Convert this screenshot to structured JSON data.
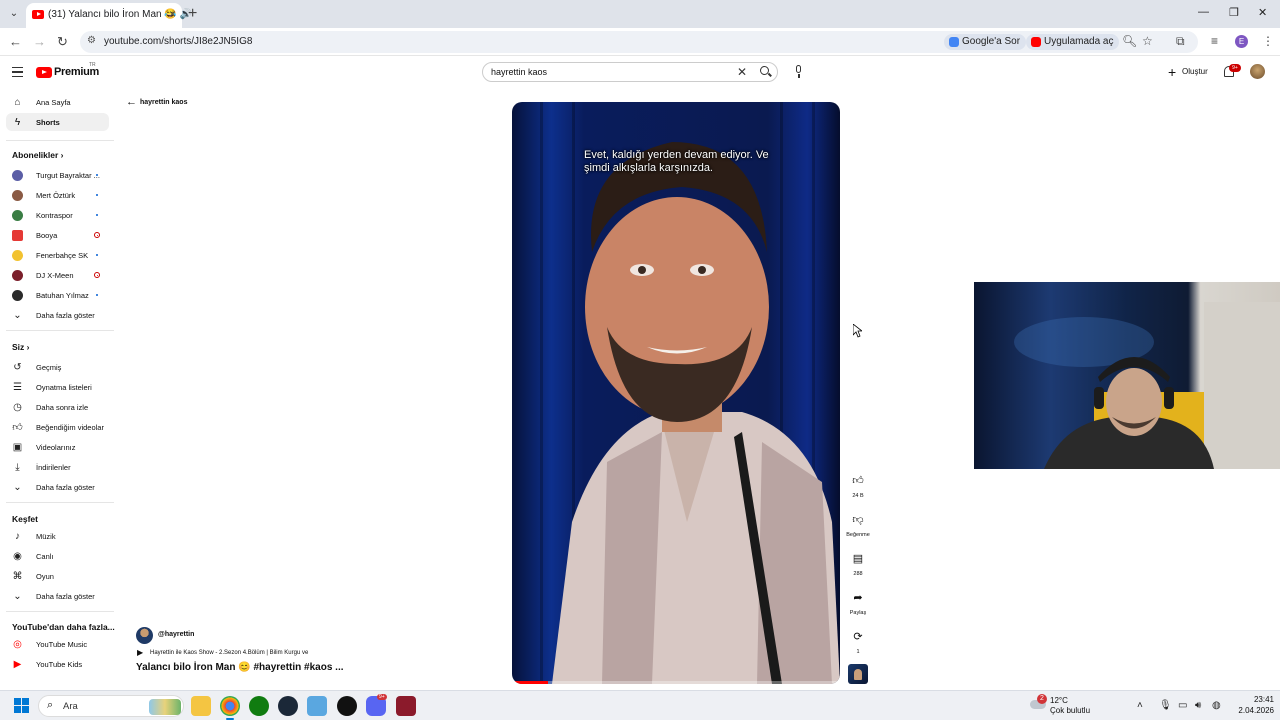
{
  "browser": {
    "tab_title": "(31) Yalancı bilo İron Man 😂 🔊",
    "url": "youtube.com/shorts/JI8e2JN5IG8",
    "chip_google": "Google'a Sor",
    "chip_app": "Uygulamada aç",
    "profile_initial": "E"
  },
  "header": {
    "brand": "Premium",
    "region": "TR",
    "search_value": "hayrettin kaos",
    "create_label": "Oluştur",
    "notifications_badge": "9+"
  },
  "sidebar": {
    "main": [
      {
        "label": "Ana Sayfa",
        "icon": "home-icon"
      },
      {
        "label": "Shorts",
        "icon": "shorts-icon"
      }
    ],
    "subs_heading": "Abonelikler",
    "subscriptions": [
      {
        "label": "Turgut Bayraktar ...",
        "color": "#5b5ea6",
        "status": "new"
      },
      {
        "label": "Mert Öztürk",
        "color": "#8a5a44",
        "status": "new"
      },
      {
        "label": "Kontraspor",
        "color": "#3a7d44",
        "status": "new"
      },
      {
        "label": "Booya",
        "color": "#e53935",
        "status": "live"
      },
      {
        "label": "Fenerbahçe SK",
        "color": "#f2c230",
        "status": "new"
      },
      {
        "label": "DJ X-Meen",
        "color": "#7b1f2b",
        "status": "live"
      },
      {
        "label": "Batuhan Yılmaz",
        "color": "#2b2b2b",
        "status": "new"
      }
    ],
    "subs_more": "Daha fazla göster",
    "you_heading": "Siz",
    "you": [
      {
        "label": "Geçmiş",
        "icon": "history-icon"
      },
      {
        "label": "Oynatma listeleri",
        "icon": "playlists-icon"
      },
      {
        "label": "Daha sonra izle",
        "icon": "watch-later-icon"
      },
      {
        "label": "Beğendiğim videolar",
        "icon": "liked-icon"
      },
      {
        "label": "Videolarınız",
        "icon": "your-videos-icon"
      },
      {
        "label": "İndirilenler",
        "icon": "downloads-icon"
      }
    ],
    "you_more": "Daha fazla göster",
    "explore_heading": "Keşfet",
    "explore": [
      {
        "label": "Müzik",
        "icon": "music-icon"
      },
      {
        "label": "Canlı",
        "icon": "live-icon"
      },
      {
        "label": "Oyun",
        "icon": "gaming-icon"
      }
    ],
    "explore_more": "Daha fazla göster",
    "more_heading": "YouTube'dan daha fazla...",
    "more": [
      {
        "label": "YouTube Music",
        "icon": "youtube-music-icon"
      },
      {
        "label": "YouTube Kids",
        "icon": "youtube-kids-icon"
      }
    ]
  },
  "main": {
    "back_label": "hayrettin kaos",
    "caption": "Evet, kaldığı yerden devam ediyor. Ve şimdi alkışlarla karşınızda.",
    "progress": 0.11,
    "channel_handle": "@hayrettin",
    "episode": "Hayrettin ile Kaos Show - 2.Sezon 4.Bölüm | Bilim Kurgu ve",
    "title": "Yalancı bilo İron Man 😊 #hayrettin #kaos ..."
  },
  "actions": [
    {
      "name": "like",
      "label": "24 B"
    },
    {
      "name": "dislike",
      "label": "Beğenme"
    },
    {
      "name": "comments",
      "label": "288"
    },
    {
      "name": "share",
      "label": "Paylaş"
    },
    {
      "name": "remix",
      "label": "1"
    }
  ],
  "taskbar": {
    "search_label": "Ara",
    "temp": "12°C",
    "condition": "Çok bulutlu",
    "weather_badge": "2",
    "time": "23:41",
    "date": "2.04.2026",
    "app_badge": "9+"
  }
}
